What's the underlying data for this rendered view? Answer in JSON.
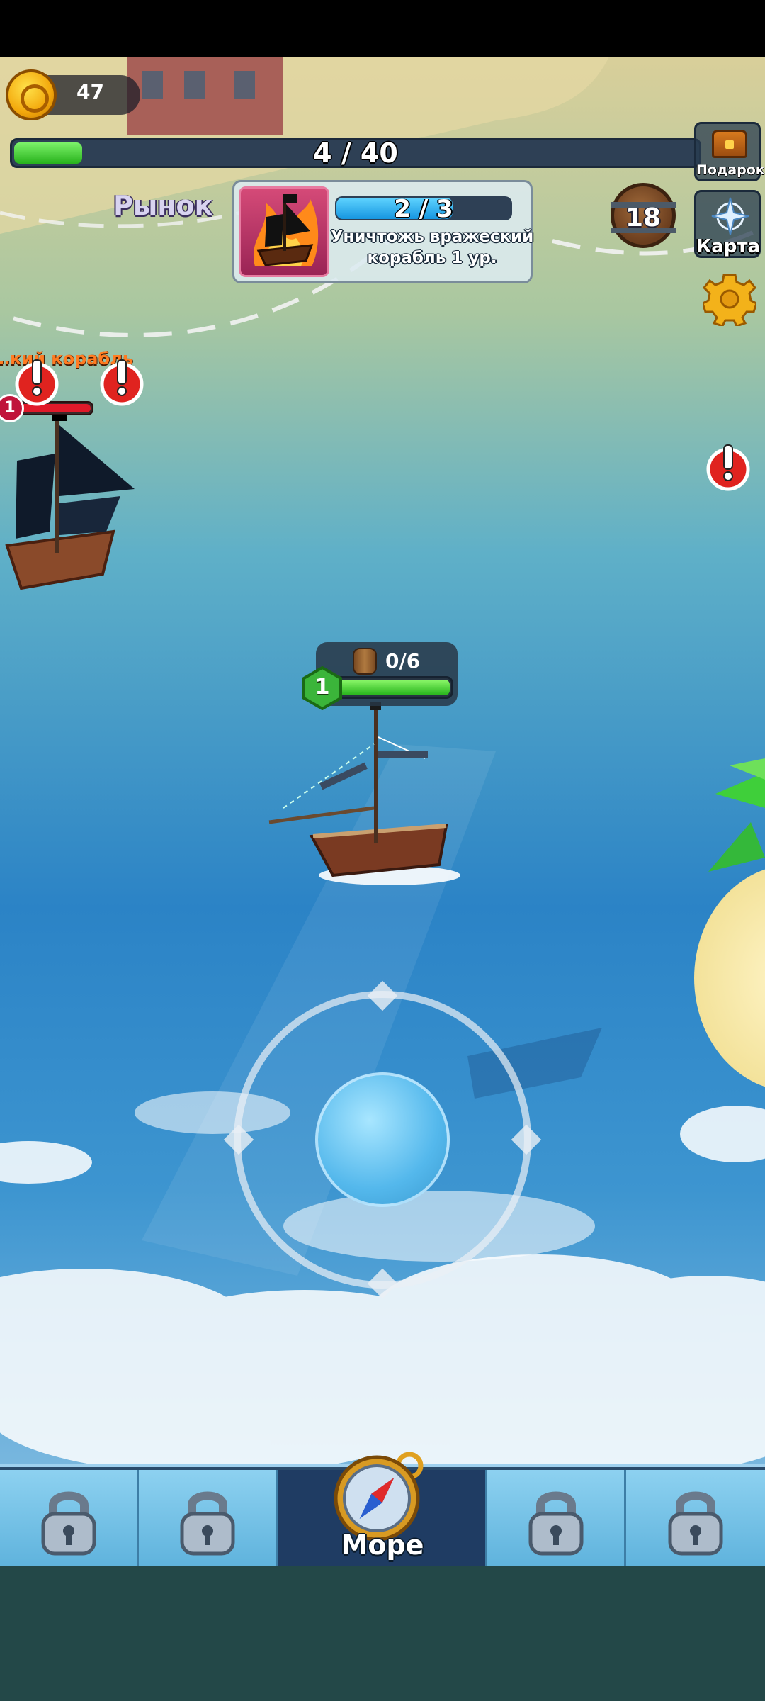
{
  "hud": {
    "coins": "47",
    "progress_text": "4 / 40",
    "progress_fraction": 0.1,
    "gift_label": "Подарок",
    "map_label": "Карта",
    "market_label": "Рынок",
    "barrel_count": "18"
  },
  "quest": {
    "progress_text": "2 / 3",
    "progress_fraction": 0.667,
    "description": "Уничтожь вражеский корабль 1 ур."
  },
  "enemy": {
    "label": "…кий корабль",
    "level": "1",
    "hp_fraction": 1.0
  },
  "player": {
    "cargo": "0/6",
    "level": "1",
    "hp_fraction": 1.0
  },
  "nav": {
    "tabs": [
      {
        "label": "",
        "locked": true
      },
      {
        "label": "",
        "locked": true
      },
      {
        "label": "Море",
        "locked": false,
        "active": true
      },
      {
        "label": "",
        "locked": true
      },
      {
        "label": "",
        "locked": true
      }
    ]
  },
  "colors": {
    "xp_green": "#28b21c",
    "quest_blue": "#1696e0",
    "enemy_red": "#e01a2a",
    "alert_red": "#e0231f",
    "sea": "#2e86c8"
  }
}
